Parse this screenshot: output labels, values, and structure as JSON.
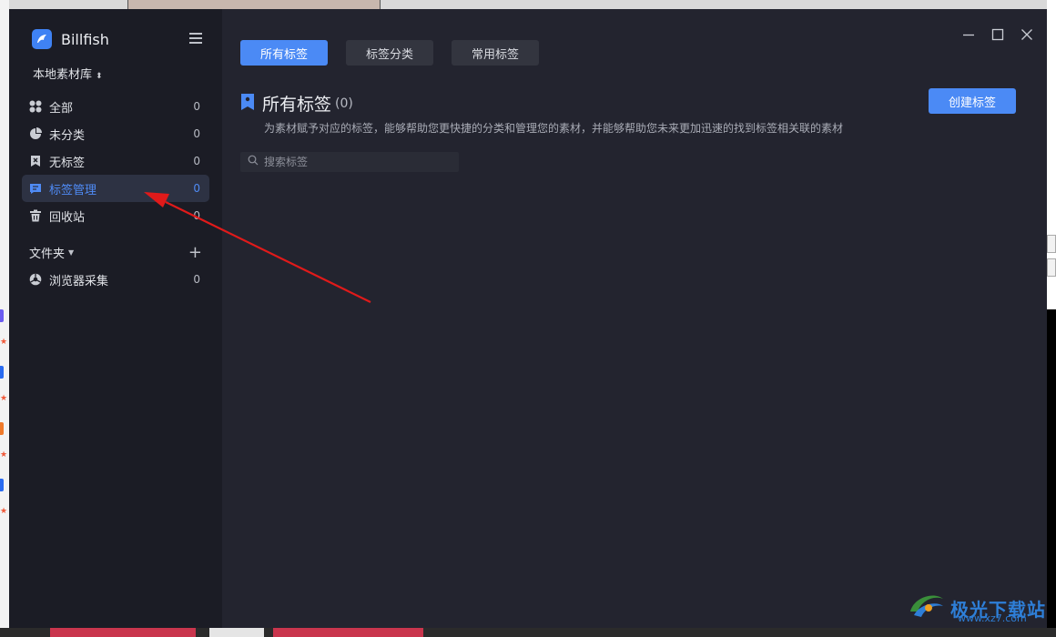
{
  "app": {
    "name": "Billfish",
    "library": "本地素材库"
  },
  "sidebar": {
    "items": [
      {
        "label": "全部",
        "count": "0",
        "icon": "grid-icon"
      },
      {
        "label": "未分类",
        "count": "0",
        "icon": "pie-icon"
      },
      {
        "label": "无标签",
        "count": "0",
        "icon": "no-tag-icon"
      },
      {
        "label": "标签管理",
        "count": "0",
        "icon": "tag-manage-icon",
        "active": true
      },
      {
        "label": "回收站",
        "count": "0",
        "icon": "trash-icon"
      }
    ],
    "folder_header": "文件夹",
    "folders": [
      {
        "label": "浏览器采集",
        "count": "0",
        "icon": "browser-collect-icon"
      }
    ]
  },
  "tabs": [
    {
      "label": "所有标签",
      "active": true
    },
    {
      "label": "标签分类",
      "active": false
    },
    {
      "label": "常用标签",
      "active": false
    }
  ],
  "main": {
    "title": "所有标签",
    "count": "(0)",
    "description": "为素材赋予对应的标签，能够帮助您更快捷的分类和管理您的素材，并能够帮助您未来更加迅速的找到标签相关联的素材",
    "create_button": "创建标签",
    "search_placeholder": "搜索标签"
  },
  "watermark": {
    "text": "极光下载站",
    "url": "www.xz7.com"
  },
  "colors": {
    "accent": "#4b8af5",
    "sidebar_bg": "#1b1c25",
    "main_bg": "#23242f",
    "arrow": "#e01a1a"
  }
}
